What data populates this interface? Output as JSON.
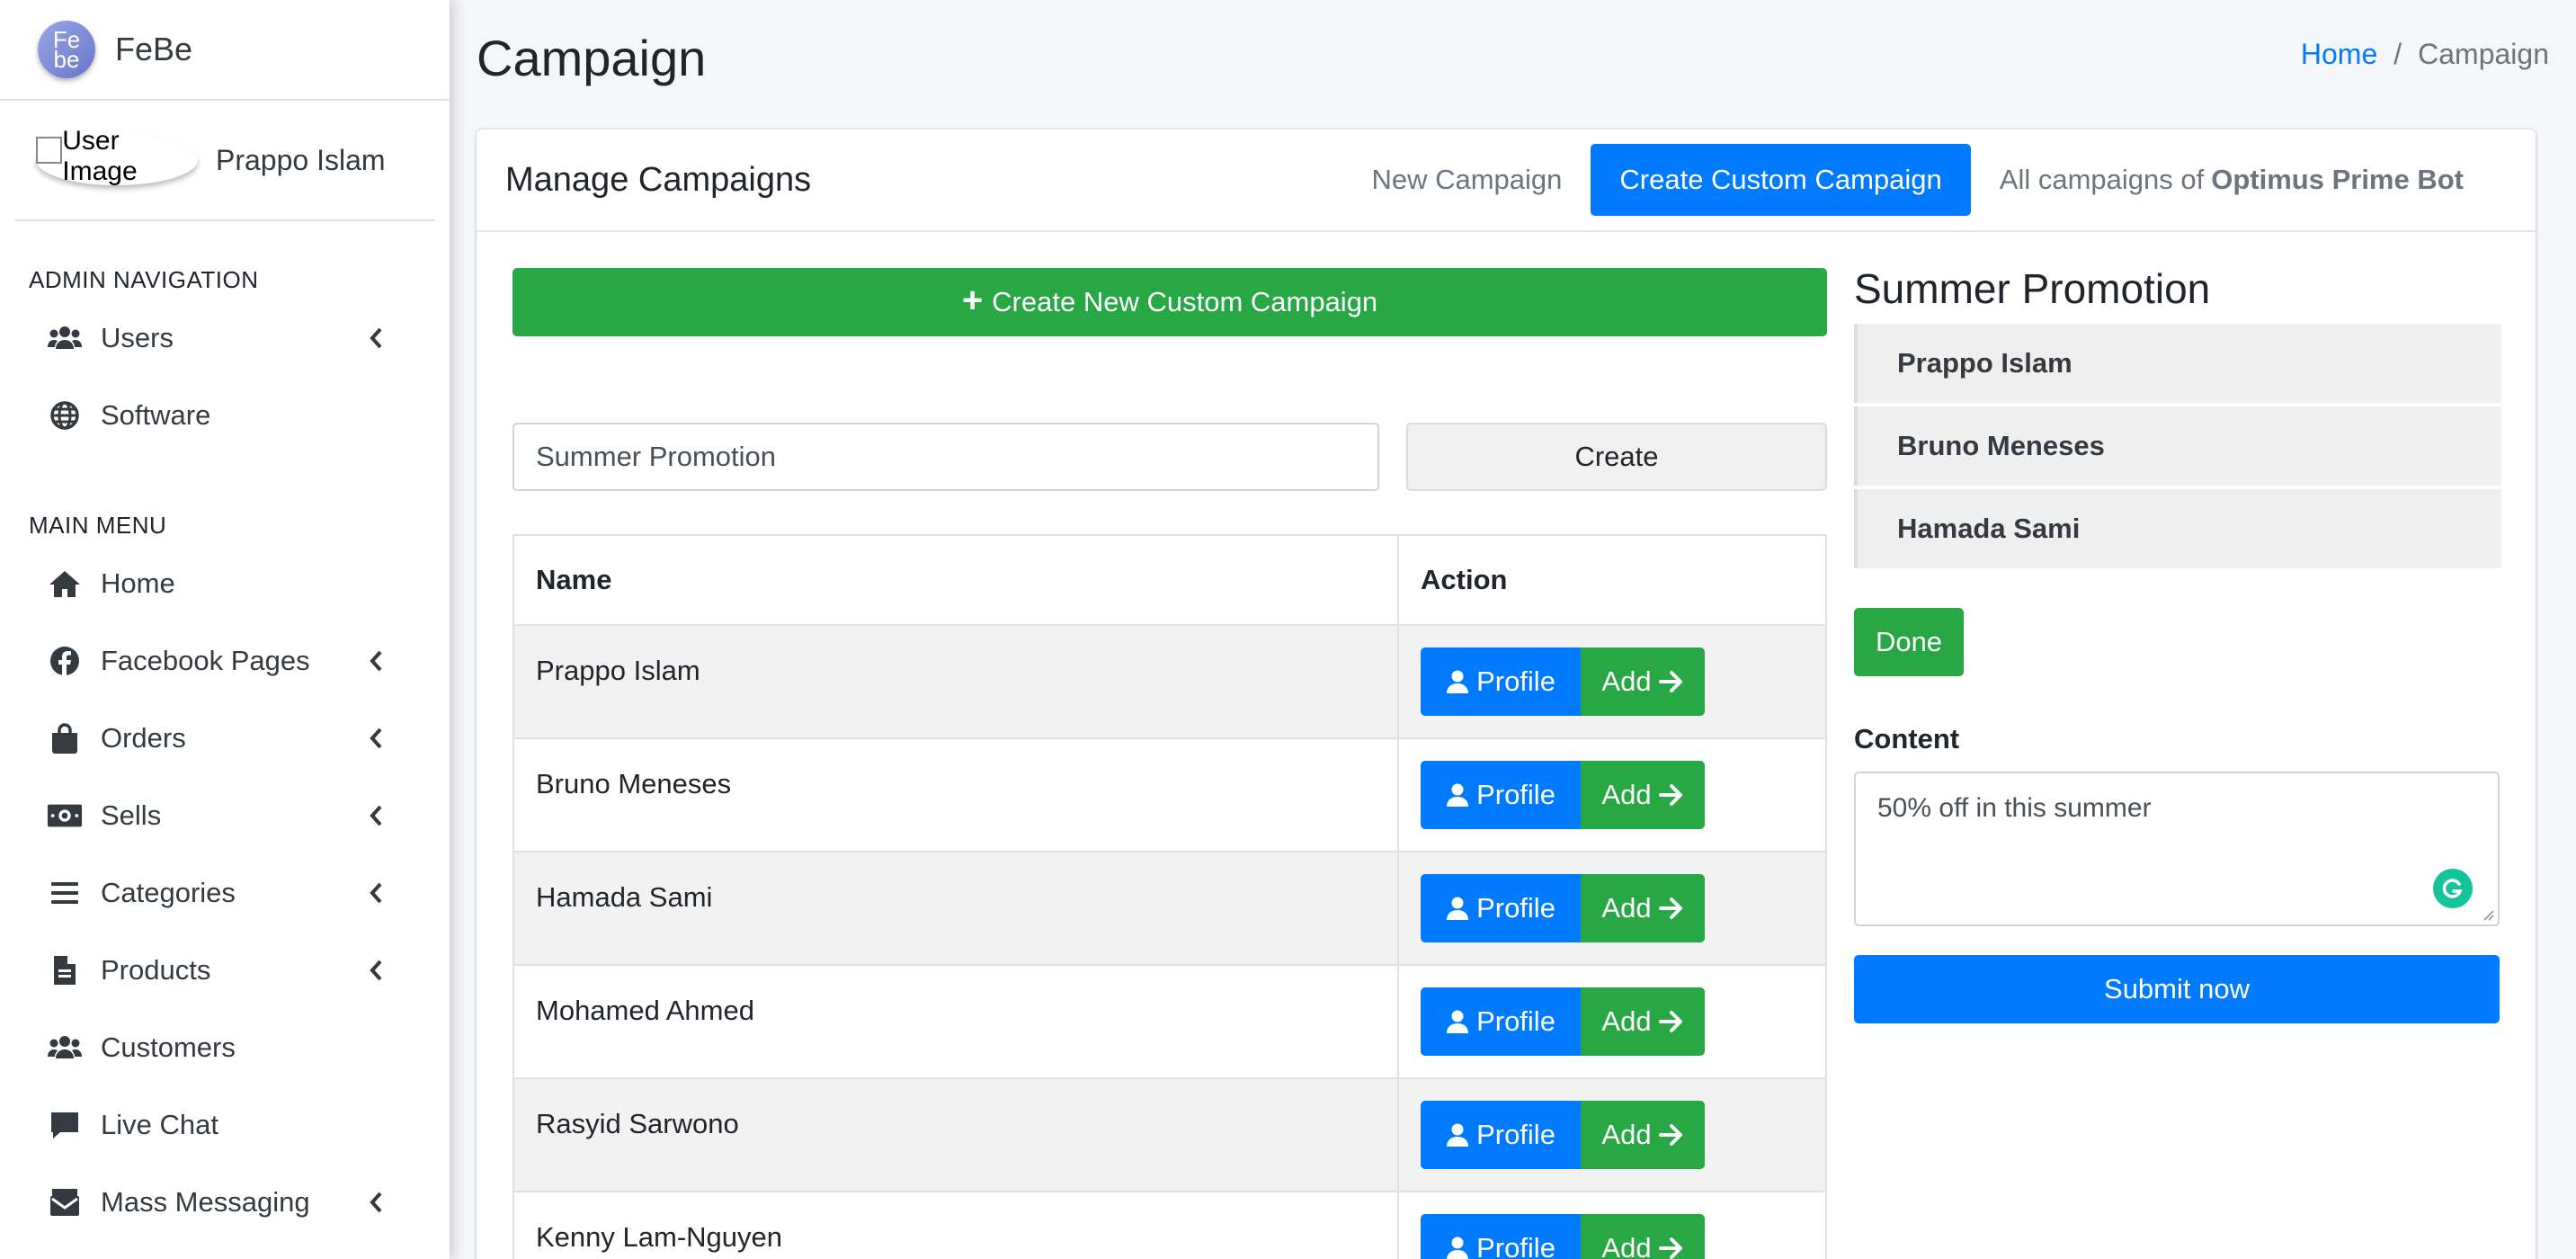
{
  "brand": {
    "logo_top": "Fe",
    "logo_bottom": "be",
    "name": "FeBe"
  },
  "user": {
    "image_alt": "User Image",
    "name": "Prappo Islam"
  },
  "sidebar": {
    "admin_header": "ADMIN NAVIGATION",
    "admin_items": [
      {
        "label": "Users",
        "icon": "users-icon",
        "has_children": true
      },
      {
        "label": "Software",
        "icon": "globe-icon",
        "has_children": false
      }
    ],
    "main_header": "MAIN MENU",
    "main_items": [
      {
        "label": "Home",
        "icon": "home-icon",
        "has_children": false
      },
      {
        "label": "Facebook Pages",
        "icon": "facebook-icon",
        "has_children": true
      },
      {
        "label": "Orders",
        "icon": "shopping-bag-icon",
        "has_children": true
      },
      {
        "label": "Sells",
        "icon": "money-bill-icon",
        "has_children": true
      },
      {
        "label": "Categories",
        "icon": "list-icon",
        "has_children": true
      },
      {
        "label": "Products",
        "icon": "file-icon",
        "has_children": true
      },
      {
        "label": "Customers",
        "icon": "users-icon",
        "has_children": false
      },
      {
        "label": "Live Chat",
        "icon": "comment-icon",
        "has_children": false
      },
      {
        "label": "Mass Messaging",
        "icon": "mail-bulk-icon",
        "has_children": true
      }
    ]
  },
  "header": {
    "title": "Campaign",
    "breadcrumb": {
      "home": "Home",
      "separator": "/",
      "current": "Campaign"
    }
  },
  "card": {
    "title": "Manage Campaigns",
    "tabs": {
      "new_campaign": "New Campaign",
      "create_custom": "Create Custom Campaign",
      "all_prefix": "All campaigns of",
      "all_bot": "Optimus Prime Bot"
    },
    "create_new_button": "Create New Custom Campaign",
    "name_input_value": "Summer Promotion",
    "create_button": "Create",
    "table": {
      "headers": {
        "name": "Name",
        "action": "Action"
      },
      "profile_label": "Profile",
      "add_label": "Add",
      "rows": [
        "Prappo Islam",
        "Bruno Meneses",
        "Hamada Sami",
        "Mohamed Ahmed",
        "Rasyid Sarwono",
        "Kenny Lam-Nguyen"
      ]
    }
  },
  "right_panel": {
    "title": "Summer Promotion",
    "selected": [
      "Prappo Islam",
      "Bruno Meneses",
      "Hamada Sami"
    ],
    "done_button": "Done",
    "content_label": "Content",
    "content_value": "50% off in this summer",
    "submit_button": "Submit now"
  },
  "colors": {
    "primary": "#007bff",
    "success": "#28a745",
    "sidebar_bg": "#ffffff",
    "content_bg": "#f4f6f9",
    "text_dark": "#343a40"
  }
}
